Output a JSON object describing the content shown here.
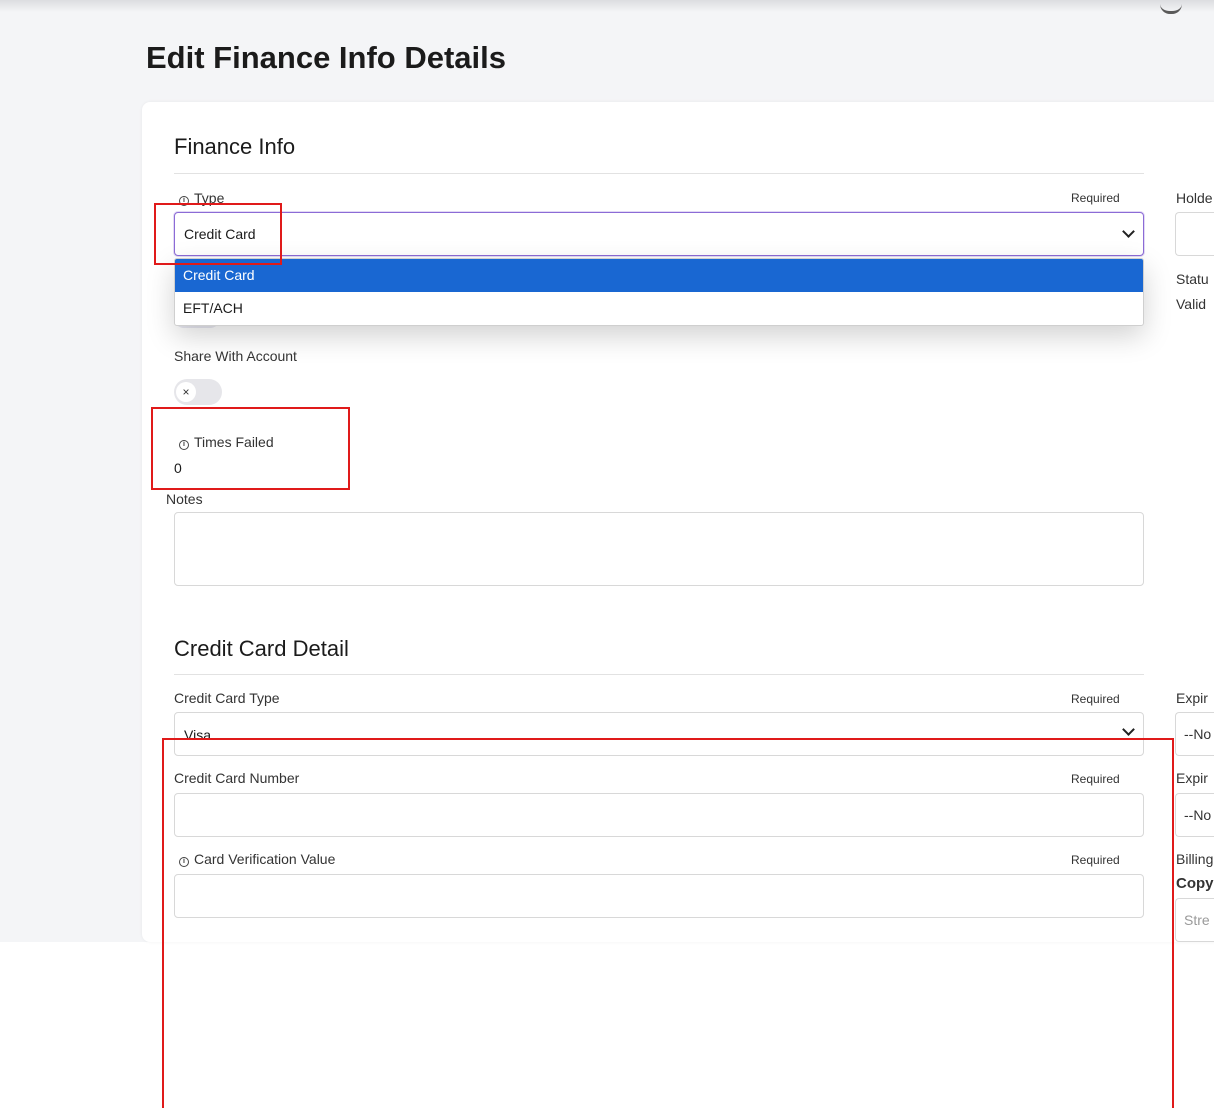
{
  "page": {
    "title": "Edit Finance Info Details"
  },
  "finance_info": {
    "section_title": "Finance Info",
    "type_field": {
      "label": "Type",
      "required": "Required",
      "selected": "Credit Card",
      "options": [
        "Credit Card",
        "EFT/ACH"
      ]
    },
    "share_with_account": {
      "label": "Share With Account",
      "toggle_icon": "×",
      "enabled": false
    },
    "times_failed": {
      "label": "Times Failed",
      "value": "0"
    },
    "notes": {
      "label": "Notes",
      "value": ""
    },
    "right_column": {
      "holder_label": "Holde",
      "status_label": "Statu",
      "status_value": "Valid"
    }
  },
  "credit_card_detail": {
    "section_title": "Credit Card Detail",
    "card_type": {
      "label": "Credit Card Type",
      "required": "Required",
      "value": "Visa"
    },
    "card_number": {
      "label": "Credit Card Number",
      "required": "Required",
      "value": ""
    },
    "cvv": {
      "label": "Card Verification Value",
      "required": "Required",
      "value": ""
    },
    "right_column": {
      "expiry_label_1": "Expir",
      "expiry_value_1": "--No",
      "expiry_label_2": "Expir",
      "expiry_value_2": "--No",
      "billing_label": "Billing",
      "copy_label": "Copy",
      "street_placeholder": "Stre"
    }
  },
  "colors": {
    "page_background": "#f4f5f7",
    "focus_border": "#8c6bd6",
    "selected_option": "#1967d2",
    "annotation_red": "#e01a1a"
  }
}
